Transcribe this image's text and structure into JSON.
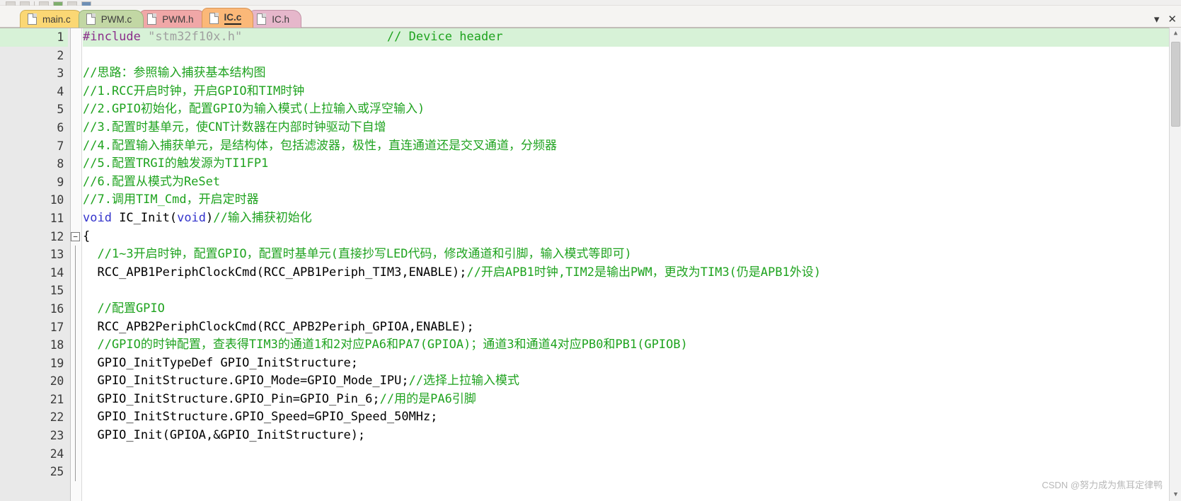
{
  "window": {
    "controls": [
      {
        "name": "dropdown-arrow",
        "glyph": "▾"
      },
      {
        "name": "close",
        "glyph": "✕"
      }
    ]
  },
  "tabs": [
    {
      "label": "main.c",
      "color": "#fbd774",
      "active": false
    },
    {
      "label": "PWM.c",
      "color": "#c2d7a4",
      "active": false
    },
    {
      "label": "PWM.h",
      "color": "#f0a7a7",
      "active": false
    },
    {
      "label": "IC.c",
      "color": "#fbb878",
      "active": true
    },
    {
      "label": "IC.h",
      "color": "#e6b7cb",
      "active": false
    }
  ],
  "editor": {
    "current_line": 1,
    "fold_marker_line": 12,
    "fold_glyph": "−",
    "lines": [
      {
        "n": "1",
        "highlight": true,
        "segments": [
          {
            "cls": "pre",
            "t": "#include "
          },
          {
            "cls": "str",
            "t": "\"stm32f10x.h\""
          },
          {
            "cls": "plain",
            "t": "                    "
          },
          {
            "cls": "cmt",
            "t": "// Device header"
          }
        ]
      },
      {
        "n": "2",
        "segments": []
      },
      {
        "n": "3",
        "segments": [
          {
            "cls": "cmt",
            "t": "//思路：参照输入捕获基本结构图"
          }
        ]
      },
      {
        "n": "4",
        "segments": [
          {
            "cls": "cmt",
            "t": "//1.RCC开启时钟，开启GPIO和TIM时钟"
          }
        ]
      },
      {
        "n": "5",
        "segments": [
          {
            "cls": "cmt",
            "t": "//2.GPIO初始化，配置GPIO为输入模式(上拉输入或浮空输入)"
          }
        ]
      },
      {
        "n": "6",
        "segments": [
          {
            "cls": "cmt",
            "t": "//3.配置时基单元，使CNT计数器在内部时钟驱动下自增"
          }
        ]
      },
      {
        "n": "7",
        "segments": [
          {
            "cls": "cmt",
            "t": "//4.配置输入捕获单元，是结构体，包括滤波器，极性，直连通道还是交叉通道，分频器"
          }
        ]
      },
      {
        "n": "8",
        "segments": [
          {
            "cls": "cmt",
            "t": "//5.配置TRGI的触发源为TI1FP1"
          }
        ]
      },
      {
        "n": "9",
        "segments": [
          {
            "cls": "cmt",
            "t": "//6.配置从模式为ReSet"
          }
        ]
      },
      {
        "n": "10",
        "segments": [
          {
            "cls": "cmt",
            "t": "//7.调用TIM_Cmd，开启定时器"
          }
        ]
      },
      {
        "n": "11",
        "segments": [
          {
            "cls": "kw",
            "t": "void"
          },
          {
            "cls": "plain",
            "t": " IC_Init("
          },
          {
            "cls": "kw",
            "t": "void"
          },
          {
            "cls": "plain",
            "t": ")"
          },
          {
            "cls": "cmt",
            "t": "//输入捕获初始化"
          }
        ]
      },
      {
        "n": "12",
        "fold": true,
        "segments": [
          {
            "cls": "plain",
            "t": "{"
          }
        ]
      },
      {
        "n": "13",
        "bar": true,
        "segments": [
          {
            "cls": "cmt",
            "t": "  //1~3开启时钟，配置GPIO，配置时基单元(直接抄写LED代码，修改通道和引脚，输入模式等即可)"
          }
        ]
      },
      {
        "n": "14",
        "bar": true,
        "segments": [
          {
            "cls": "plain",
            "t": "  RCC_APB1PeriphClockCmd(RCC_APB1Periph_TIM3,ENABLE);"
          },
          {
            "cls": "cmt",
            "t": "//开启APB1时钟,TIM2是输出PWM，更改为TIM3(仍是APB1外设)"
          }
        ]
      },
      {
        "n": "15",
        "bar": true,
        "segments": []
      },
      {
        "n": "16",
        "bar": true,
        "segments": [
          {
            "cls": "cmt",
            "t": "  //配置GPIO"
          }
        ]
      },
      {
        "n": "17",
        "bar": true,
        "segments": [
          {
            "cls": "plain",
            "t": "  RCC_APB2PeriphClockCmd(RCC_APB2Periph_GPIOA,ENABLE);"
          }
        ]
      },
      {
        "n": "18",
        "bar": true,
        "segments": [
          {
            "cls": "cmt",
            "t": "  //GPIO的时钟配置，查表得TIM3的通道1和2对应PA6和PA7(GPIOA)；通道3和通道4对应PB0和PB1(GPIOB)"
          }
        ]
      },
      {
        "n": "19",
        "bar": true,
        "segments": [
          {
            "cls": "plain",
            "t": "  GPIO_InitTypeDef GPIO_InitStructure;"
          }
        ]
      },
      {
        "n": "20",
        "bar": true,
        "segments": [
          {
            "cls": "plain",
            "t": "  GPIO_InitStructure.GPIO_Mode=GPIO_Mode_IPU;"
          },
          {
            "cls": "cmt",
            "t": "//选择上拉输入模式"
          }
        ]
      },
      {
        "n": "21",
        "bar": true,
        "segments": [
          {
            "cls": "plain",
            "t": "  GPIO_InitStructure.GPIO_Pin=GPIO_Pin_6;"
          },
          {
            "cls": "cmt",
            "t": "//用的是PA6引脚"
          }
        ]
      },
      {
        "n": "22",
        "bar": true,
        "segments": [
          {
            "cls": "plain",
            "t": "  GPIO_InitStructure.GPIO_Speed=GPIO_Speed_50MHz;"
          }
        ]
      },
      {
        "n": "23",
        "bar": true,
        "segments": [
          {
            "cls": "plain",
            "t": "  GPIO_Init(GPIOA,&GPIO_InitStructure);"
          }
        ]
      },
      {
        "n": "24",
        "bar": true,
        "segments": []
      },
      {
        "n": "25",
        "bar": true,
        "segments": []
      }
    ]
  },
  "watermark": {
    "text": "CSDN @努力成为焦耳定律鸭"
  }
}
